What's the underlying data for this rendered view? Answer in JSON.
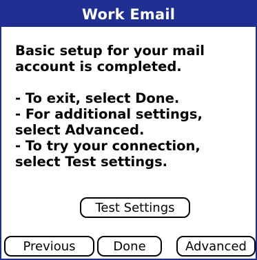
{
  "dialog": {
    "title": "Work Email"
  },
  "message": {
    "paragraphs": [
      {
        "lines": [
          "Basic setup for your mail",
          "account is completed."
        ]
      },
      {
        "lines": [
          "- To exit, select Done.",
          "- For additional settings,",
          "select Advanced.",
          "- To try your connection,",
          "select Test settings."
        ]
      }
    ]
  },
  "buttons": {
    "test_settings": "Test Settings",
    "previous": "Previous",
    "done": "Done",
    "advanced": "Advanced"
  },
  "colors": {
    "title_bar": "#1f2f92",
    "title_text": "#ffffff",
    "border": "#1c2f8f"
  }
}
